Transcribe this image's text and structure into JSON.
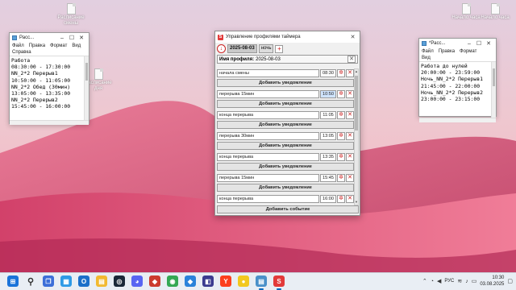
{
  "desktop": {
    "icons": [
      {
        "label": "Расписание смены"
      },
      {
        "label": "Расписание дня"
      },
      {
        "label": "Начало часа"
      },
      {
        "label": "Начало часа"
      }
    ]
  },
  "notepad_left": {
    "title": "Расс...",
    "menu": [
      "Файл",
      "Правка",
      "Формат",
      "Вид",
      "Справка"
    ],
    "lines": [
      "Работа",
      "08:30:00 - 17:30:00",
      "NN_2*2 Перерыв1",
      "10:50:00 - 11:05:00",
      "NN_2*2 Обед (30мин)",
      "13:05:00 - 13:35:00",
      "NN_2*2 Перерыв2",
      "15:45:00 - 16:00:00"
    ]
  },
  "notepad_right": {
    "title": "*Расс...",
    "menu": [
      "Файл",
      "Правка",
      "Формат",
      "Вид"
    ],
    "lines": [
      "Работа до нулей",
      "20:00:00 - 23:59:00",
      "Ночь_NN_2*2 Перерыв1",
      "21:45:00 - 22:00:00",
      "Ночь_NN_2*2 Перерыв2",
      "23:00:00 - 23:15:00"
    ]
  },
  "timer_manager": {
    "title": "Управление профилями таймера",
    "tabs": [
      {
        "label": "2025-08-03"
      },
      {
        "label": "ночь"
      }
    ],
    "profile_label": "Имя профиля:",
    "profile_value": "2025-08-03",
    "add_notification_label": "Добавить уведомление",
    "add_event_label": "Добавить событие",
    "events": [
      {
        "name": "начала смены",
        "time": "08:30"
      },
      {
        "name": "перерыва 15мин",
        "time": "10:50"
      },
      {
        "name": "конца перерыва",
        "time": "11:05"
      },
      {
        "name": "перерыва 30мин",
        "time": "13:05"
      },
      {
        "name": "конца перерыва",
        "time": "13:35"
      },
      {
        "name": "перерыва 15мин",
        "time": "15:45"
      },
      {
        "name": "конца перерыва",
        "time": "16:00"
      }
    ]
  },
  "taskbar": {
    "language": "РУС",
    "time": "10:30",
    "date": "03.08.2025",
    "apps": [
      {
        "icon": "windows-start-icon",
        "color": "#1a73d9"
      },
      {
        "icon": "search-icon",
        "color": "#333333"
      },
      {
        "icon": "task-view-icon",
        "color": "#3d6fd8"
      },
      {
        "icon": "widgets-icon",
        "color": "#2e9ae6"
      },
      {
        "icon": "outlook-icon",
        "color": "#1b6fc9"
      },
      {
        "icon": "explorer-icon",
        "color": "#f2b930"
      },
      {
        "icon": "steam-icon",
        "color": "#1b2838"
      },
      {
        "icon": "discord-icon",
        "color": "#5865f2"
      },
      {
        "icon": "app-icon",
        "color": "#cc3b2e"
      },
      {
        "icon": "chrome-icon",
        "color": "#34a853"
      },
      {
        "icon": "app-icon",
        "color": "#2a82da"
      },
      {
        "icon": "ide-icon",
        "color": "#3b3b8f"
      },
      {
        "icon": "yandex-icon",
        "color": "#fc3f1d"
      },
      {
        "icon": "yandex-browser-icon",
        "color": "#f2c81f"
      },
      {
        "icon": "notepad-icon",
        "color": "#4a90c9"
      },
      {
        "icon": "timer-app-icon",
        "color": "#e23a3a"
      }
    ]
  }
}
